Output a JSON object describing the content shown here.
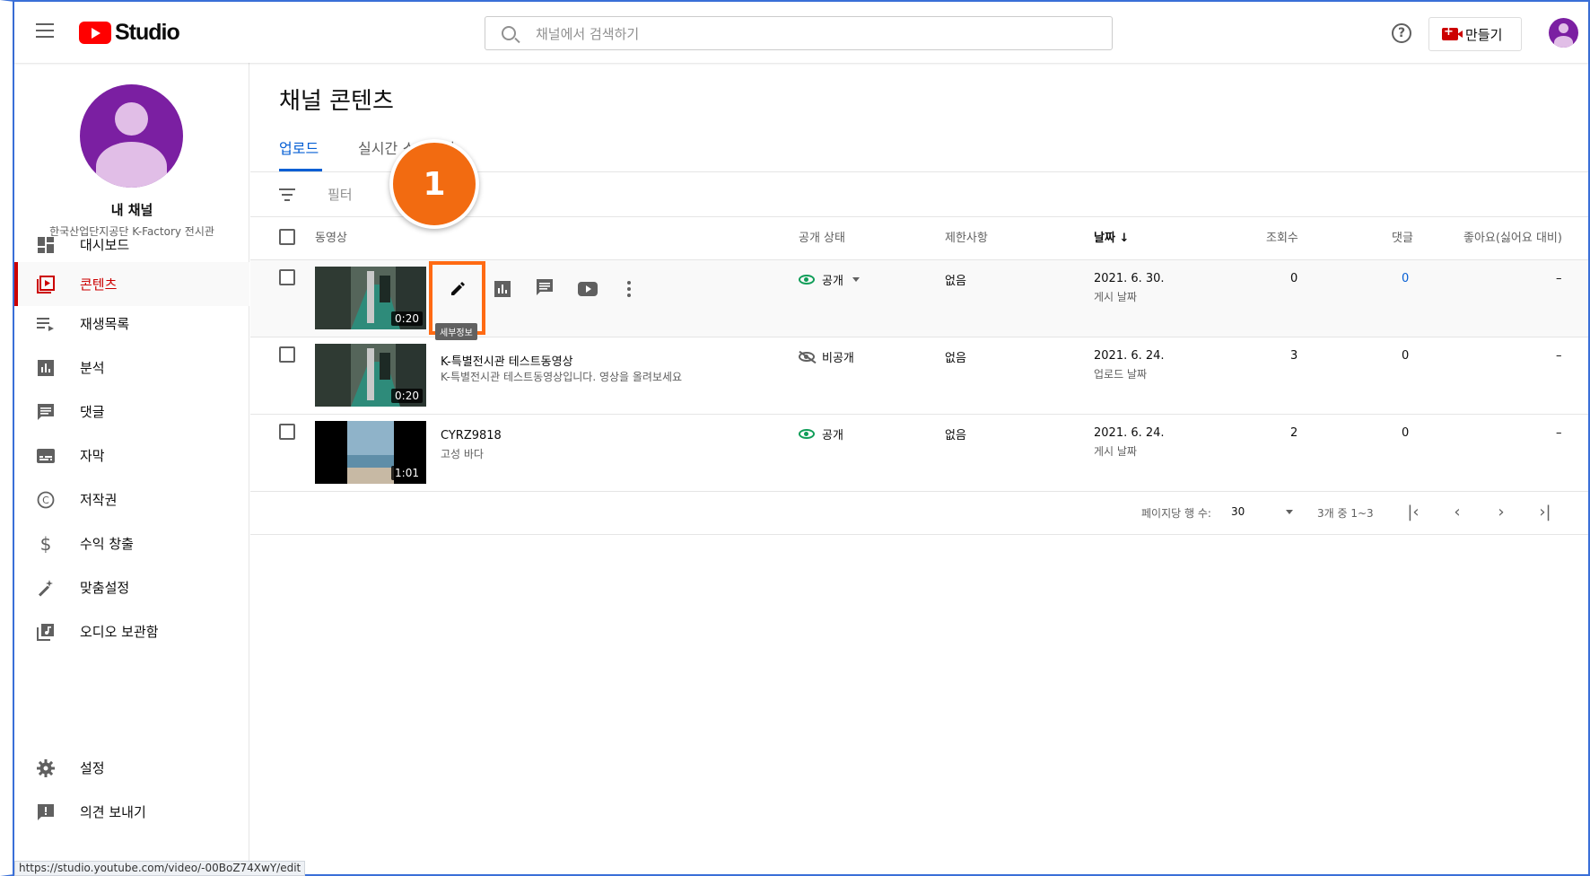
{
  "header": {
    "logo_text": "Studio",
    "search_placeholder": "채널에서 검색하기",
    "help_label": "?",
    "create_label": "만들기"
  },
  "sidebar": {
    "channel_name": "내 채널",
    "channel_subtitle": "한국산업단지공단 K-Factory 전시관",
    "items": [
      {
        "label": "대시보드",
        "icon": "dashboard-icon"
      },
      {
        "label": "콘텐츠",
        "icon": "content-icon",
        "active": true
      },
      {
        "label": "재생목록",
        "icon": "playlist-icon"
      },
      {
        "label": "분석",
        "icon": "analytics-icon"
      },
      {
        "label": "댓글",
        "icon": "comments-icon"
      },
      {
        "label": "자막",
        "icon": "subtitles-icon"
      },
      {
        "label": "저작권",
        "icon": "copyright-icon"
      },
      {
        "label": "수익 창출",
        "icon": "dollar-icon"
      },
      {
        "label": "맞춤설정",
        "icon": "wand-icon"
      },
      {
        "label": "오디오 보관함",
        "icon": "audio-library-icon"
      }
    ],
    "bottom_items": [
      {
        "label": "설정",
        "icon": "gear-icon"
      },
      {
        "label": "의견 보내기",
        "icon": "feedback-icon"
      }
    ],
    "status_url": "https://studio.youtube.com/video/-00BoZ74XwY/edit"
  },
  "main": {
    "title": "채널 콘텐츠",
    "tabs": [
      {
        "label": "업로드",
        "active": true
      },
      {
        "label": "실시간 스트리밍"
      }
    ],
    "filter_label": "필터",
    "columns": [
      "동영상",
      "공개 상태",
      "제한사항",
      "날짜",
      "조회수",
      "댓글",
      "좋아요(싫어요 대비)"
    ],
    "rows": [
      {
        "title": "",
        "description": "",
        "duration": "0:20",
        "visibility": "공개",
        "restriction": "없음",
        "date": "2021. 6. 30.",
        "date_type": "게시 날짜",
        "views": "0",
        "comments": "0",
        "likes": "–"
      },
      {
        "title": "K-특별전시관 테스트동영상",
        "description": "K-특별전시관 테스트동영상입니다. 영상을 올려보세요",
        "duration": "0:20",
        "visibility": "비공개",
        "restriction": "없음",
        "date": "2021. 6. 24.",
        "date_type": "업로드 날짜",
        "views": "3",
        "comments": "0",
        "likes": "–"
      },
      {
        "title": "CYRZ9818",
        "description": "고성 바다",
        "duration": "1:01",
        "visibility": "공개",
        "restriction": "없음",
        "date": "2021. 6. 24.",
        "date_type": "게시 날짜",
        "views": "2",
        "comments": "0",
        "likes": "–"
      }
    ],
    "tooltip": "세부정보",
    "step_badge": "1",
    "pagination": {
      "rows_per_page_label": "페이지당 행 수:",
      "rows_per_page": "30",
      "range": "3개 중 1~3"
    }
  },
  "colors": {
    "accent_blue": "#065fd4",
    "active_red": "#cc0000",
    "highlight_orange": "#ff6a13",
    "public_green": "#0f9d58"
  }
}
